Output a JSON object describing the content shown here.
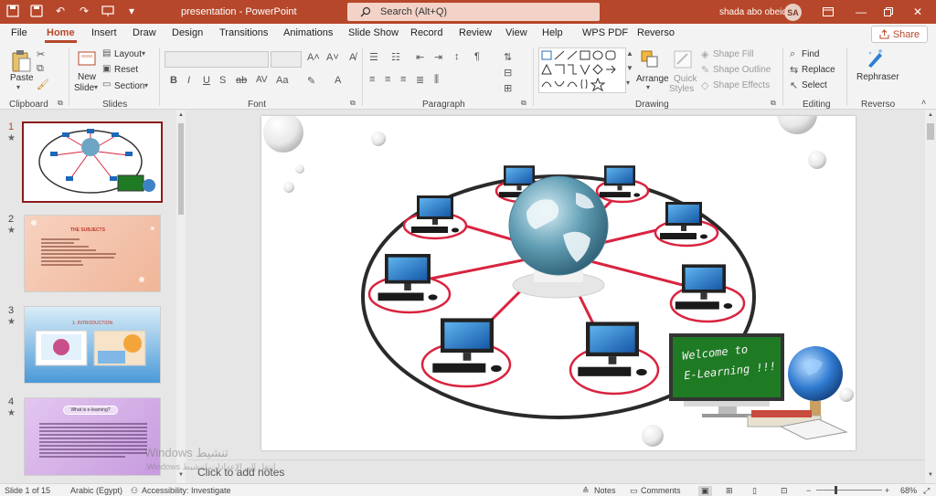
{
  "titlebar": {
    "doc_title": "presentation - PowerPoint",
    "search_placeholder": "Search (Alt+Q)",
    "user_name": "shada abo obeid",
    "user_initials": "SA"
  },
  "tabs": [
    "File",
    "Home",
    "Insert",
    "Draw",
    "Design",
    "Transitions",
    "Animations",
    "Slide Show",
    "Record",
    "Review",
    "View",
    "Help",
    "WPS PDF",
    "Reverso"
  ],
  "active_tab": "Home",
  "share_label": "Share",
  "ribbon": {
    "clipboard": {
      "label": "Clipboard",
      "paste": "Paste"
    },
    "slides": {
      "label": "Slides",
      "new_slide_line1": "New",
      "new_slide_line2": "Slide",
      "layout": "Layout",
      "reset": "Reset",
      "section": "Section"
    },
    "font": {
      "label": "Font"
    },
    "paragraph": {
      "label": "Paragraph"
    },
    "drawing": {
      "label": "Drawing",
      "arrange": "Arrange",
      "quick_styles_line1": "Quick",
      "quick_styles_line2": "Styles",
      "shape_fill": "Shape Fill",
      "shape_outline": "Shape Outline",
      "shape_effects": "Shape Effects"
    },
    "editing": {
      "label": "Editing",
      "find": "Find",
      "replace": "Replace",
      "select": "Select"
    },
    "reverso": {
      "label": "Reverso",
      "rephraser": "Rephraser"
    }
  },
  "thumbnails": [
    {
      "num": "1",
      "star": "★"
    },
    {
      "num": "2",
      "star": "★",
      "title": "THE SUBJECTS"
    },
    {
      "num": "3",
      "star": "★",
      "title": "1- INTRODUCTION"
    },
    {
      "num": "4",
      "star": "★",
      "title": "What is e-learning?"
    }
  ],
  "slide": {
    "chalkboard_line1": "Welcome to",
    "chalkboard_line2": "E-Learning !!!"
  },
  "notes_placeholder": "Click to add notes",
  "watermark_line1": "تنشيط Windows",
  "watermark_line2": "انتقل إلى الإعدادات لتنشيط Windows.",
  "status": {
    "slide_info": "Slide 1 of 15",
    "language": "Arabic (Egypt)",
    "accessibility": "Accessibility: Investigate",
    "notes": "Notes",
    "comments": "Comments",
    "zoom": "68%"
  },
  "colors": {
    "accent": "#b7472a",
    "chalkboard": "#1f7a24",
    "ring": "#d9233f"
  }
}
